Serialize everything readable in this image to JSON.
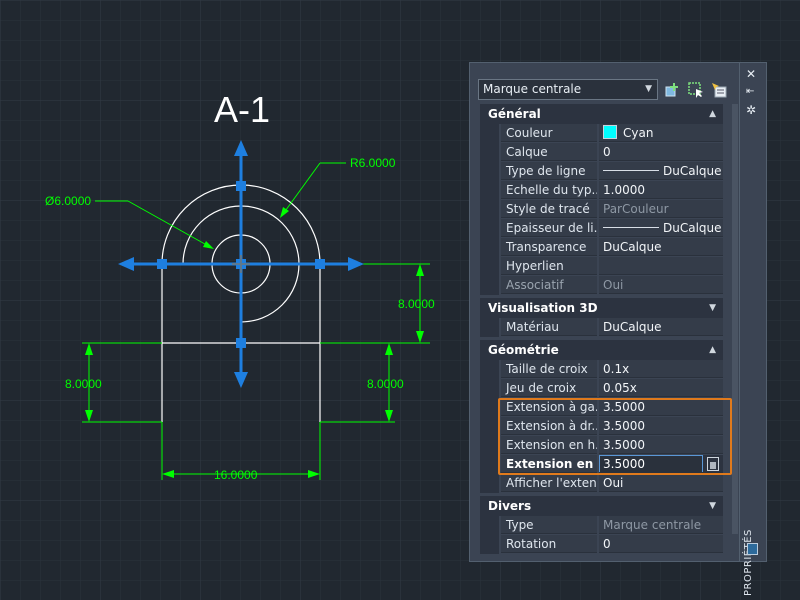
{
  "drawing": {
    "title": "A-1",
    "dims": {
      "radius_label": "R6.0000",
      "diameter_label": "Ø6.0000",
      "right_height": "8.0000",
      "left_height": "8.0000",
      "center_height": "8.0000",
      "width": "16.0000"
    }
  },
  "palette": {
    "selected_object": "Marque centrale",
    "strip_label": "PROPRIÉTÉS",
    "sections": {
      "general": "Général",
      "visual3d": "Visualisation 3D",
      "geometry": "Géométrie",
      "misc": "Divers"
    },
    "general_rows": [
      {
        "name": "Couleur",
        "value": "Cyan"
      },
      {
        "name": "Calque",
        "value": "0"
      },
      {
        "name": "Type de ligne",
        "value": "DuCalque"
      },
      {
        "name": "Echelle du typ...",
        "value": "1.0000"
      },
      {
        "name": "Style de tracé",
        "value": "ParCouleur"
      },
      {
        "name": "Epaisseur de li...",
        "value": "DuCalque"
      },
      {
        "name": "Transparence",
        "value": "DuCalque"
      },
      {
        "name": "Hyperlien",
        "value": ""
      },
      {
        "name": "Associatif",
        "value": "Oui"
      }
    ],
    "visual_rows": [
      {
        "name": "Matériau",
        "value": "DuCalque"
      }
    ],
    "geometry_rows": [
      {
        "name": "Taille de croix",
        "value": "0.1x"
      },
      {
        "name": "Jeu de croix",
        "value": "0.05x"
      },
      {
        "name": "Extension à ga...",
        "value": "3.5000"
      },
      {
        "name": "Extension à dr...",
        "value": "3.5000"
      },
      {
        "name": "Extension en h...",
        "value": "3.5000"
      },
      {
        "name": "Extension en b...",
        "value": "3.5000"
      },
      {
        "name": "Afficher l'exten...",
        "value": "Oui"
      }
    ],
    "misc_rows": [
      {
        "name": "Type",
        "value": "Marque centrale"
      },
      {
        "name": "Rotation",
        "value": "0"
      }
    ]
  },
  "colors": {
    "canvas": "#212830",
    "dimension": "#00ff00",
    "grip": "#1e7fe0",
    "highlight": "#e07a1c"
  }
}
